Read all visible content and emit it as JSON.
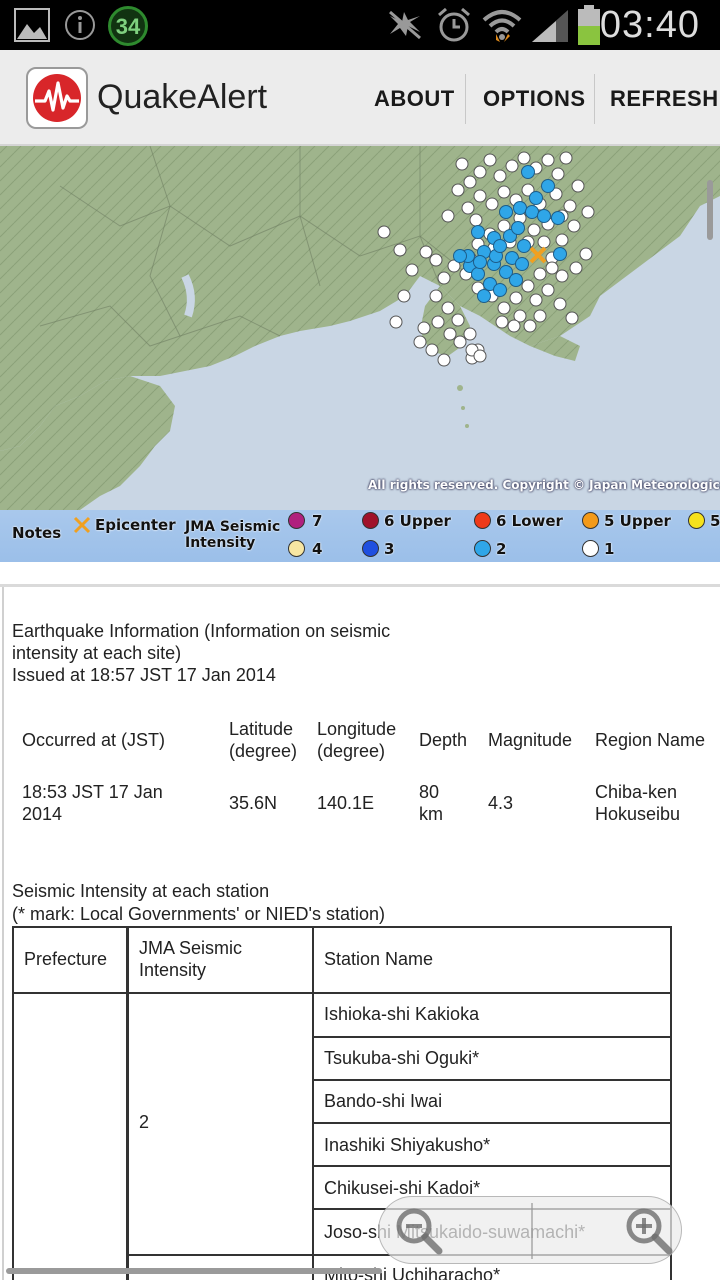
{
  "status_bar": {
    "time": "03:40",
    "badge_number": "34",
    "icons": [
      "gallery-icon",
      "info-icon",
      "circle-badge-icon",
      "mute-icon",
      "alarm-icon",
      "wifi-icon",
      "signal-icon",
      "battery-icon"
    ]
  },
  "action_bar": {
    "app_name": "QuakeAlert",
    "buttons": [
      "ABOUT",
      "OPTIONS",
      "REFRESH"
    ]
  },
  "map": {
    "copyright": "All rights reserved. Copyright © Japan Meteorological Age"
  },
  "legend": {
    "notes_label": "Notes",
    "epicenter_label": "Epicenter",
    "intensity_label_line1": "JMA Seismic",
    "intensity_label_line2": "Intensity",
    "items": [
      {
        "label": "7",
        "color": "#b0207e"
      },
      {
        "label": "6 Upper",
        "color": "#a0122a"
      },
      {
        "label": "6 Lower",
        "color": "#ee3a1a"
      },
      {
        "label": "5 Upper",
        "color": "#f39a1a"
      },
      {
        "label": "5",
        "color": "#f6e21c"
      },
      {
        "label": "4",
        "color": "#f7e6a2"
      },
      {
        "label": "3",
        "color": "#1f4fe0"
      },
      {
        "label": "2",
        "color": "#2fa6e8"
      },
      {
        "label": "1",
        "color": "#ffffff"
      }
    ]
  },
  "info": {
    "heading_line1": "Earthquake Information (Information on seismic",
    "heading_line2": "intensity at each site)",
    "issued": "Issued at 18:57 JST 17 Jan 2014",
    "columns": {
      "occurred": "Occurred at (JST)",
      "latitude_1": "Latitude",
      "latitude_2": "(degree)",
      "longitude_1": "Longitude",
      "longitude_2": "(degree)",
      "depth": "Depth",
      "magnitude": "Magnitude",
      "region": "Region Name"
    },
    "row": {
      "occurred_1": "18:53 JST 17 Jan",
      "occurred_2": "2014",
      "latitude": "35.6N",
      "longitude": "140.1E",
      "depth_1": "80",
      "depth_2": "km",
      "magnitude": "4.3",
      "region_1": "Chiba-ken",
      "region_2": "Hokuseibu"
    }
  },
  "stations": {
    "heading": "Seismic Intensity at each station",
    "note": "(* mark: Local Governments' or NIED's station)",
    "headers": {
      "prefecture": "Prefecture",
      "intensity_1": "JMA Seismic",
      "intensity_2": "Intensity",
      "station": "Station Name"
    },
    "intensity_value": "2",
    "rows": [
      "Ishioka-shi Kakioka",
      "Tsukuba-shi Oguki*",
      "Bando-shi Iwai",
      "Inashiki Shiyakusho*",
      "Chikusei-shi Kadoi*",
      "Joso-shi Mitsukaido-suwamachi*",
      "Mito-shi Uchiharacho*"
    ]
  }
}
